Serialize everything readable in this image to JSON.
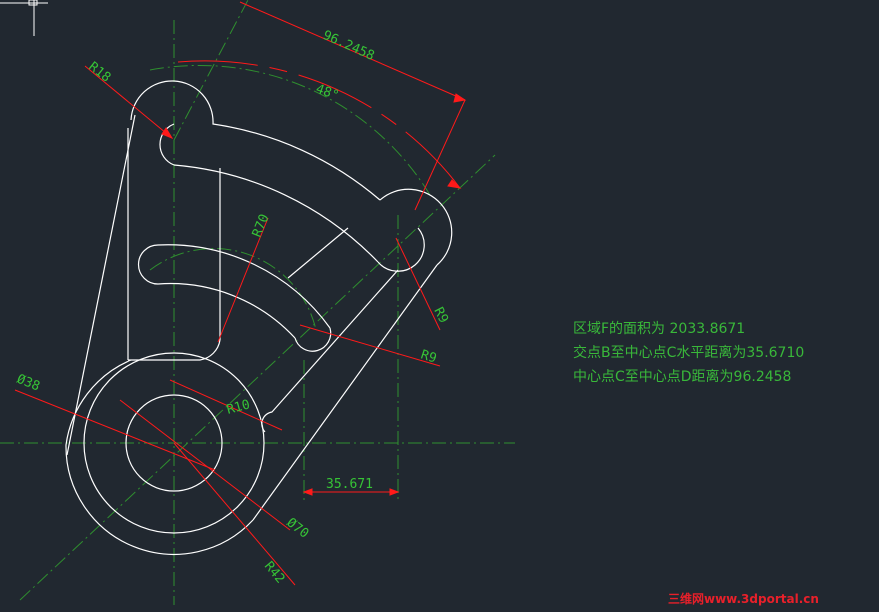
{
  "dimensions": {
    "r18": "R18",
    "r70": "R70",
    "r9_upper": "R9",
    "r9_lower": "R9",
    "r10": "R10",
    "dia38": "Ø38",
    "dia70": "Ø70",
    "r42": "R42",
    "angle": "48°",
    "distance_cd": "96.2458",
    "horizontal_bc": "35.671"
  },
  "info_lines": [
    "区域F的面积为 2033.8671",
    "交点B至中心点C水平距离为35.6710",
    "中心点C至中心点D距离为96.2458"
  ],
  "watermark": "三维网www.3dportal.cn",
  "colors": {
    "background": "#212830",
    "geometry": "#ffffff",
    "dimension_line": "#ff1a1a",
    "centerline": "#2f8f2f",
    "text": "#39b83a"
  },
  "icons": {
    "ucs": "crosshair-cursor-icon"
  }
}
